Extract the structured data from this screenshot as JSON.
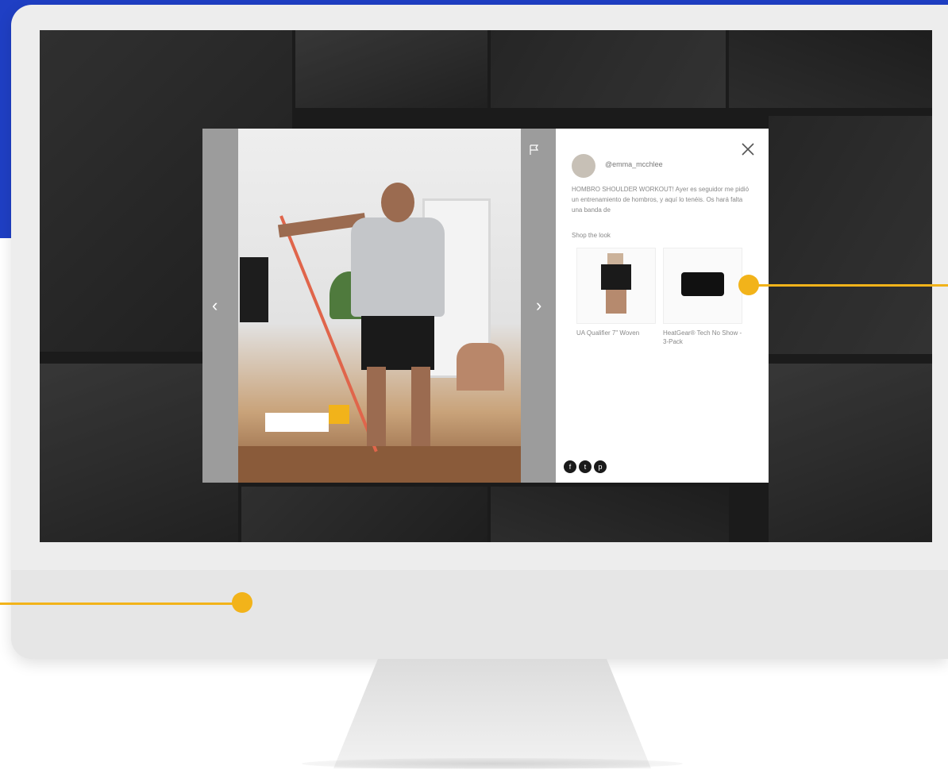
{
  "post": {
    "username": "@emma_mcchlee",
    "caption": "HOMBRO SHOULDER WORKOUT! Ayer es seguidor me pidió un entrenamiento de hombros, y aquí lo tenéis. Os hará falta una banda de",
    "shop_title": "Shop the look"
  },
  "products": [
    {
      "name": "UA Qualifier 7\" Woven"
    },
    {
      "name": "HeatGear® Tech No Show - 3-Pack"
    }
  ],
  "nav": {
    "prev": "‹",
    "next": "›"
  },
  "social": [
    {
      "icon": "facebook-icon",
      "glyph": "f"
    },
    {
      "icon": "twitter-icon",
      "glyph": "t"
    },
    {
      "icon": "pinterest-icon",
      "glyph": "p"
    }
  ],
  "colors": {
    "brand_blue": "#1f3fc4",
    "accent_yellow": "#f2b31a"
  }
}
